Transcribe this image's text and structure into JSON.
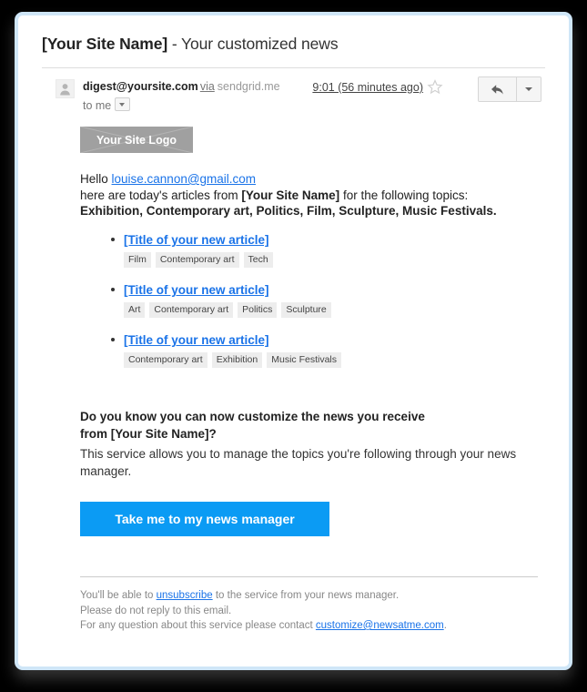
{
  "email": {
    "subject_site_name": "[Your Site Name]",
    "subject_separator": " - ",
    "subject_tail": "Your customized news",
    "sender_address": "digest@yoursite.com",
    "via_label": "via",
    "via_domain": "sendgrid.me",
    "recipients_label": "to me",
    "timestamp": "9:01 (56 minutes ago)",
    "avatar_icon": "person-icon",
    "star_icon": "star-outline-icon",
    "reply_icon": "reply-arrow-icon",
    "more_icon": "chevron-down-icon",
    "recipients_caret_icon": "chevron-down-icon"
  },
  "body": {
    "logo_text": "Your Site Logo",
    "hello_prefix": "Hello ",
    "hello_email": "louise.cannon@gmail.com",
    "intro_prefix": "here are today's articles from ",
    "intro_site_name": "[Your Site Name]",
    "intro_suffix": " for the following topics:",
    "topics_line": "Exhibition, Contemporary art, Politics, Film, Sculpture, Music Festivals.",
    "articles": [
      {
        "title": "[Title of your new article]",
        "tags": [
          "Film",
          "Contemporary art",
          "Tech"
        ]
      },
      {
        "title": "[Title of your new article]",
        "tags": [
          "Art",
          "Contemporary art",
          "Politics",
          "Sculpture"
        ]
      },
      {
        "title": "[Title of your new article]",
        "tags": [
          "Contemporary art",
          "Exhibition",
          "Music Festivals"
        ]
      }
    ]
  },
  "promo": {
    "headline_line1": "Do you know you can now customize the news you receive",
    "headline_line2": "from [Your Site Name]?",
    "subtext": "This service allows you to manage the topics you're following through your news manager.",
    "cta_label": "Take me to my news manager"
  },
  "footer": {
    "line1_prefix": "You'll be able to ",
    "line1_link": "unsubscribe",
    "line1_suffix": " to the service from your news manager.",
    "line2": "Please do not reply to this email.",
    "line3_prefix": "For any question about this service please contact ",
    "line3_link": "customize@newsatme.com",
    "line3_suffix": "."
  },
  "colors": {
    "link_blue": "#1a73e8",
    "cta_blue": "#0b9bf4",
    "frame_blue": "#cfe6f7",
    "tag_gray": "#ededed",
    "logo_gray": "#a0a0a0"
  }
}
